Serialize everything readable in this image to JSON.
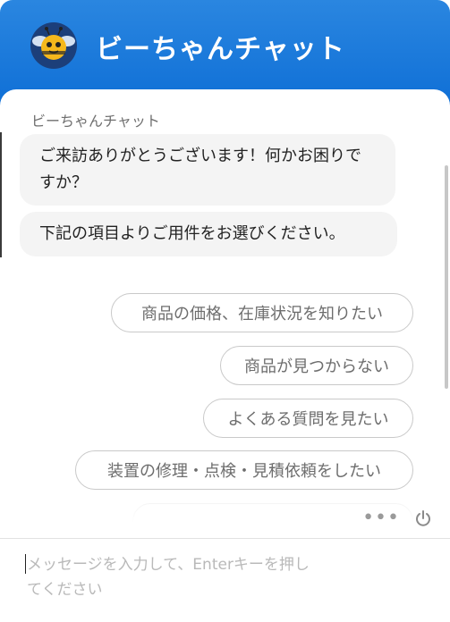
{
  "header": {
    "title": "ビーちゃんチャット",
    "avatar_icon": "bee-mascot-icon",
    "background_color": "#1a7ae0"
  },
  "chat": {
    "bot_name": "ビーちゃんチャット",
    "messages": [
      "ご来訪ありがとうございます！何かお困りですか？",
      "下記の項目よりご用件をお選びください。"
    ],
    "options": [
      "商品の価格、在庫状況を知りたい",
      "商品が見つからない",
      "よくある質問を見たい",
      "装置の修理・点検・見積依頼をしたい"
    ]
  },
  "toolbar": {
    "more_icon": "more-dots-icon",
    "power_icon": "power-icon"
  },
  "input": {
    "placeholder": "メッセージを入力して、Enterキーを押してください",
    "value": ""
  }
}
